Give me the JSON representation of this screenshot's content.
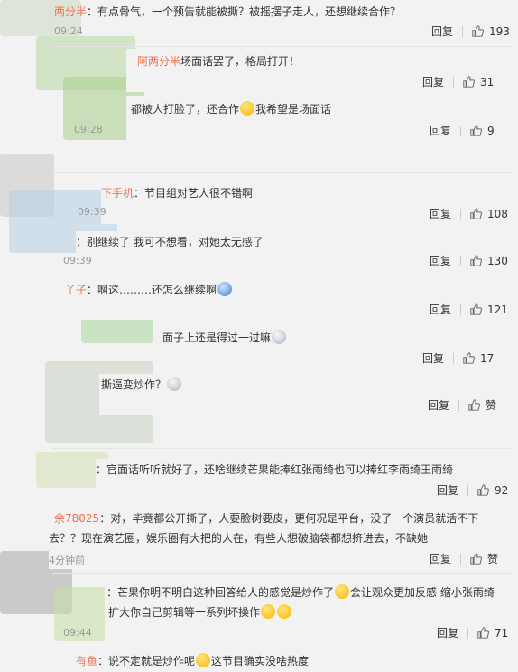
{
  "labels": {
    "reply": "回复",
    "like_empty": "赞"
  },
  "comments": [
    {
      "name": "两分半",
      "text": "：有点骨气，一个预告就能被撕？被摇摆子走人，还想继续合作？",
      "time": "09:24",
      "likes": "193"
    },
    {
      "name": "阿两分半",
      "text": "场面话罢了，格局打开！",
      "time": "",
      "likes": "31"
    },
    {
      "name": "",
      "text": "都被人打脸了，还合作",
      "emoji": "yellow-smile-emoji",
      "text2": "我希望是场面话",
      "time": "09:28",
      "likes": "9"
    },
    {
      "name": "下手机",
      "text": "：节目组对艺人很不错啊",
      "time": "09:39",
      "likes": "108"
    },
    {
      "name": "",
      "text": "：别继续了 我可不想看，对她太无感了",
      "time": "09:39",
      "likes": "130"
    },
    {
      "name": "丫子",
      "text": "：啊这………还怎么继续啊",
      "emoji": "blue-face-emoji",
      "time": "",
      "likes": "121"
    },
    {
      "name": "",
      "text": "面子上还是得过一过嘛",
      "emoji": "grey-face-emoji",
      "time": "",
      "likes": "17"
    },
    {
      "name": "",
      "text": "撕逼变炒作？",
      "emoji": "grey-face-emoji",
      "time": "",
      "likes": "赞"
    },
    {
      "name": "",
      "text": "：官面话听听就好了，还啥继续芒果能捧红张雨绮也可以捧红李雨绮王雨绮",
      "time": "",
      "likes": "92"
    },
    {
      "name": "余78025",
      "text": "：对，毕竟都公开撕了，人要脸树要皮，更何况是平台，没了一个演员就活不下",
      "text_line2": "去？？现在演艺圈，娱乐圈有大把的人在，有些人想破脑袋都想挤进去，不缺她",
      "time": "4分钟前",
      "likes": "赞"
    },
    {
      "name": "",
      "text": "：芒果你明不明白这种回答给人的感觉是炒作了",
      "emoji": "yellow-cry-emoji",
      "text2": "会让观众更加反感 缩小张雨绮",
      "text_line2": "扩大你自己剪辑等一系列坏操作",
      "time": "09:44",
      "likes": "71"
    },
    {
      "name": "有鱼",
      "text": "：说不定就是炒作呢",
      "emoji": "yellow-laugh-emoji",
      "text2": "这节目确实没啥热度",
      "time": "",
      "likes": ""
    }
  ]
}
